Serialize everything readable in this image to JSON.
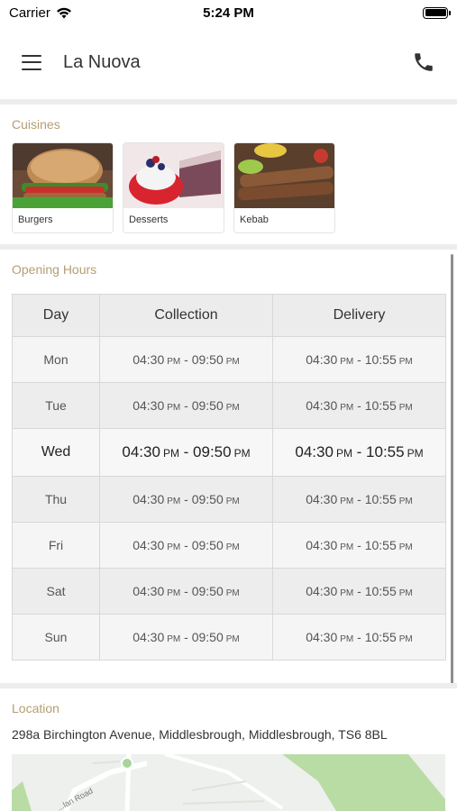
{
  "status_bar": {
    "carrier": "Carrier",
    "time": "5:24 PM"
  },
  "header": {
    "title": "La Nuova"
  },
  "cuisines": {
    "label": "Cuisines",
    "items": [
      {
        "name": "Burgers"
      },
      {
        "name": "Desserts"
      },
      {
        "name": "Kebab"
      }
    ]
  },
  "opening_hours": {
    "label": "Opening Hours",
    "columns": [
      "Day",
      "Collection",
      "Delivery"
    ],
    "rows": [
      {
        "day": "Mon",
        "collection": [
          "04:30",
          "PM",
          "09:50",
          "PM"
        ],
        "delivery": [
          "04:30",
          "PM",
          "10:55",
          "PM"
        ]
      },
      {
        "day": "Tue",
        "collection": [
          "04:30",
          "PM",
          "09:50",
          "PM"
        ],
        "delivery": [
          "04:30",
          "PM",
          "10:55",
          "PM"
        ]
      },
      {
        "day": "Wed",
        "collection": [
          "04:30",
          "PM",
          "09:50",
          "PM"
        ],
        "delivery": [
          "04:30",
          "PM",
          "10:55",
          "PM"
        ]
      },
      {
        "day": "Thu",
        "collection": [
          "04:30",
          "PM",
          "09:50",
          "PM"
        ],
        "delivery": [
          "04:30",
          "PM",
          "10:55",
          "PM"
        ]
      },
      {
        "day": "Fri",
        "collection": [
          "04:30",
          "PM",
          "09:50",
          "PM"
        ],
        "delivery": [
          "04:30",
          "PM",
          "10:55",
          "PM"
        ]
      },
      {
        "day": "Sat",
        "collection": [
          "04:30",
          "PM",
          "09:50",
          "PM"
        ],
        "delivery": [
          "04:30",
          "PM",
          "10:55",
          "PM"
        ]
      },
      {
        "day": "Sun",
        "collection": [
          "04:30",
          "PM",
          "09:50",
          "PM"
        ],
        "delivery": [
          "04:30",
          "PM",
          "10:55",
          "PM"
        ]
      }
    ],
    "highlighted_day": "Wed"
  },
  "location": {
    "label": "Location",
    "address": "298a Birchington Avenue, Middlesbrough, Middlesbrough, TS6 8BL",
    "map_road_label": "...lan Road"
  },
  "icons": {
    "menu": "hamburger-menu-icon",
    "phone": "phone-icon",
    "wifi": "wifi-icon",
    "battery": "battery-icon"
  },
  "colors": {
    "section_label": "#b49e72",
    "divider": "#ededed",
    "map_green": "#b9dca5"
  }
}
